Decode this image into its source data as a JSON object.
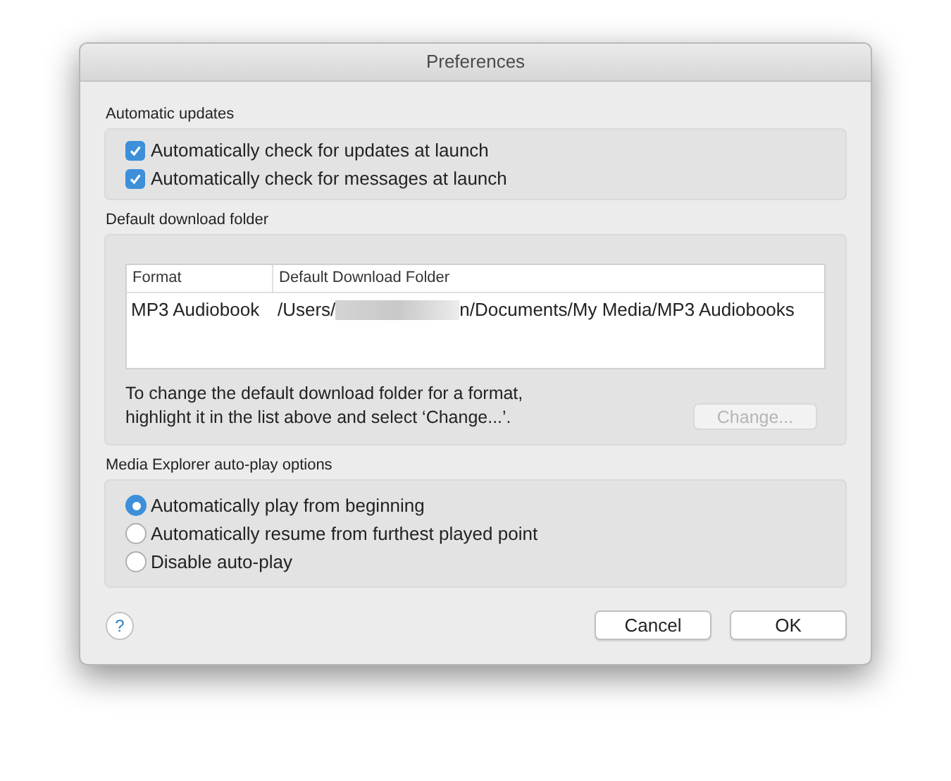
{
  "window": {
    "title": "Preferences"
  },
  "automatic_updates": {
    "title": "Automatic updates",
    "options": [
      {
        "label": "Automatically check for updates at launch",
        "checked": true
      },
      {
        "label": "Automatically check for messages at launch",
        "checked": true
      }
    ]
  },
  "download_folder": {
    "title": "Default download folder",
    "columns": [
      "Format",
      "Default Download Folder"
    ],
    "rows": [
      {
        "format": "MP3 Audiobook",
        "path_start": "/Users/",
        "path_end": "n/Documents/My Media/MP3 Audiobooks",
        "redacted": true
      }
    ],
    "hint": "To change the default download folder for a format,\nhighlight it in the list above and select ‘Change...’.",
    "change_button": {
      "label": "Change...",
      "disabled": true
    }
  },
  "auto_play": {
    "title": "Media Explorer auto-play options",
    "options": [
      {
        "label": "Automatically play from beginning",
        "selected": true
      },
      {
        "label": "Automatically resume from furthest played point",
        "selected": false
      },
      {
        "label": "Disable auto-play",
        "selected": false
      }
    ]
  },
  "help_button": {
    "label": "?"
  },
  "buttons": [
    {
      "label": "Cancel"
    },
    {
      "label": "OK"
    }
  ]
}
